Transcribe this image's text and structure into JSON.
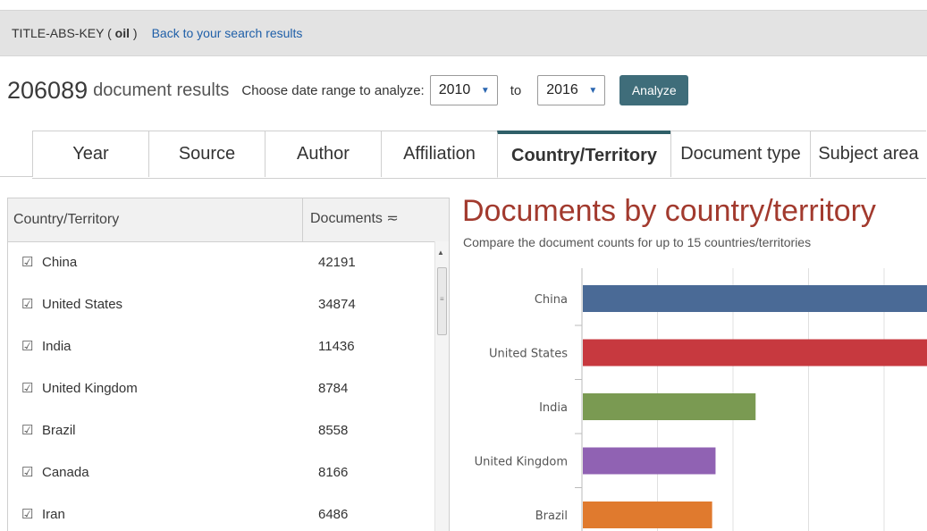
{
  "query": {
    "text_prefix": "TITLE-ABS-KEY ( ",
    "keyword": "oil",
    "text_suffix": " )",
    "back_link": "Back to your search results"
  },
  "results": {
    "count": "206089",
    "label": "document results",
    "range_label": "Choose date range to analyze:",
    "from_year": "2010",
    "to_label": "to",
    "to_year": "2016",
    "analyze_label": "Analyze"
  },
  "tabs": [
    {
      "label": "Year",
      "active": false
    },
    {
      "label": "Source",
      "active": false
    },
    {
      "label": "Author",
      "active": false
    },
    {
      "label": "Affiliation",
      "active": false
    },
    {
      "label": "Country/Territory",
      "active": true
    },
    {
      "label": "Document type",
      "active": false
    },
    {
      "label": "Subject area",
      "active": false
    }
  ],
  "table": {
    "col_country": "Country/Territory",
    "col_documents": "Documents",
    "sort_icon": "≂",
    "check_icon": "checkbox-checked-icon",
    "rows": [
      {
        "name": "China",
        "count": "42191"
      },
      {
        "name": "United States",
        "count": "34874"
      },
      {
        "name": "India",
        "count": "11436"
      },
      {
        "name": "United Kingdom",
        "count": "8784"
      },
      {
        "name": "Brazil",
        "count": "8558"
      },
      {
        "name": "Canada",
        "count": "8166"
      },
      {
        "name": "Iran",
        "count": "6486"
      }
    ]
  },
  "chart_data": {
    "type": "bar",
    "title": "Documents by country/territory",
    "subtitle": "Compare the document counts for up to 15 countries/territories",
    "orientation": "horizontal",
    "categories": [
      "China",
      "United States",
      "India",
      "United Kingdom",
      "Brazil"
    ],
    "values": [
      42191,
      34874,
      11436,
      8784,
      8558
    ],
    "colors": [
      "#4a6a96",
      "#c7393f",
      "#7a9a52",
      "#9062b3",
      "#e07a2e"
    ],
    "grid": true,
    "xlim": [
      0,
      20000
    ]
  }
}
